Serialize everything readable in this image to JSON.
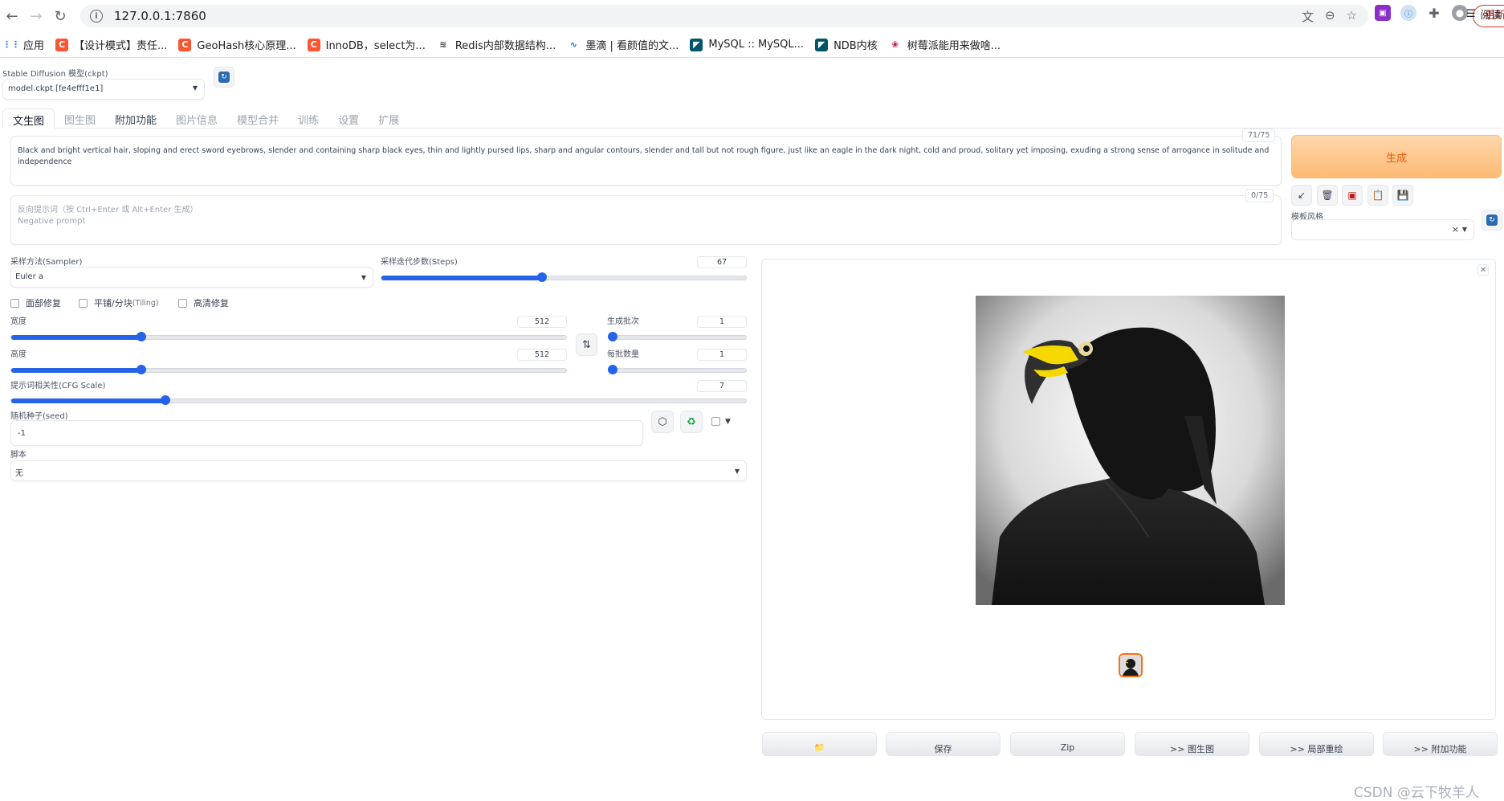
{
  "browser": {
    "url": "127.0.0.1:7860",
    "update_label": "更新",
    "bookmarks": [
      {
        "label": "应用",
        "color": "#4285f4",
        "glyph": "⋮⋮"
      },
      {
        "label": "【设计模式】责任...",
        "color": "#fc5531",
        "glyph": "C"
      },
      {
        "label": "GeoHash核心原理...",
        "color": "#fc5531",
        "glyph": "C"
      },
      {
        "label": "InnoDB，select为...",
        "color": "#fc5531",
        "glyph": "C"
      },
      {
        "label": "Redis内部数据结构...",
        "color": "#444444",
        "glyph": "≋"
      },
      {
        "label": "墨滴 | 看颜值的文...",
        "color": "#1a73e8",
        "glyph": "∿"
      },
      {
        "label": "MySQL :: MySQL...",
        "color": "#00546b",
        "glyph": "◤"
      },
      {
        "label": "NDB内核",
        "color": "#00546b",
        "glyph": "◤"
      },
      {
        "label": "树莓派能用来做啥...",
        "color": "#c51a4a",
        "glyph": "❀"
      }
    ],
    "reading_list_label": "阅读"
  },
  "model": {
    "label": "Stable Diffusion 模型(ckpt)",
    "value": "model.ckpt [fe4efff1e1]"
  },
  "tabs": [
    "文生图",
    "图生图",
    "附加功能",
    "图片信息",
    "模型合并",
    "训练",
    "设置",
    "扩展"
  ],
  "prompt": {
    "text": "Black and bright vertical hair, sloping and erect sword eyebrows, slender and containing sharp black eyes, thin and lightly pursed lips, sharp and angular contours, slender and tall but not rough figure, just like an eagle in the dark night, cold and proud, solitary yet imposing, exuding a strong sense of arrogance in solitude and independence",
    "count": "71/75"
  },
  "negative": {
    "placeholder_line1": "反向提示词（按 Ctrl+Enter 或 Alt+Enter 生成）",
    "placeholder_line2": "Negative prompt",
    "count": "0/75"
  },
  "generate_label": "生成",
  "style": {
    "label": "模板风格",
    "clear": "×"
  },
  "sampler": {
    "label": "采样方法(Sampler)",
    "value": "Euler a"
  },
  "steps": {
    "label": "采样迭代步数(Steps)",
    "value": "67",
    "fraction": 0.44
  },
  "checkboxes": [
    {
      "label": "面部修复",
      "sub": ""
    },
    {
      "label": "平铺/分块",
      "sub": " (Tiling)"
    },
    {
      "label": "高清修复",
      "sub": ""
    }
  ],
  "width": {
    "label": "宽度",
    "value": "512",
    "fraction": 0.235
  },
  "height": {
    "label": "高度",
    "value": "512",
    "fraction": 0.235
  },
  "batch_count": {
    "label": "生成批次",
    "value": "1",
    "fraction": 0.0
  },
  "batch_size": {
    "label": "每批数量",
    "value": "1",
    "fraction": 0.0
  },
  "cfg": {
    "label": "提示词相关性(CFG Scale)",
    "value": "7",
    "fraction": 0.21
  },
  "seed": {
    "label": "随机种子(seed)",
    "value": "-1"
  },
  "script": {
    "label": "脚本",
    "value": "无"
  },
  "actions": [
    "",
    "保存",
    "Zip",
    ">> 图生图",
    ">> 局部重绘",
    ">> 附加功能"
  ],
  "watermark": "CSDN @云下牧羊人"
}
